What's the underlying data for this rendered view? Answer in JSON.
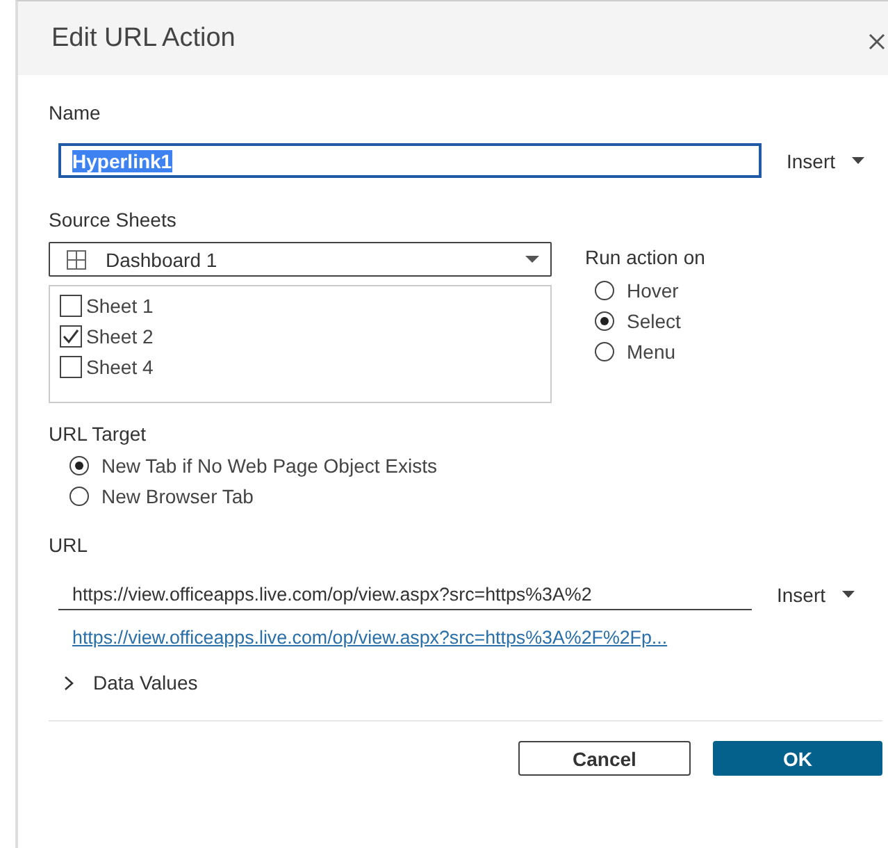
{
  "window": {
    "title": "Edit URL Action"
  },
  "name": {
    "label": "Name",
    "value": "Hyperlink1",
    "insert": "Insert"
  },
  "source_sheets": {
    "label": "Source Sheets",
    "dropdown": "Dashboard 1",
    "sheets": [
      {
        "label": "Sheet 1",
        "checked": false
      },
      {
        "label": "Sheet 2",
        "checked": true
      },
      {
        "label": "Sheet 4",
        "checked": false
      }
    ]
  },
  "run_action_on": {
    "label": "Run action on",
    "options": [
      {
        "label": "Hover",
        "selected": false
      },
      {
        "label": "Select",
        "selected": true
      },
      {
        "label": "Menu",
        "selected": false
      }
    ]
  },
  "url_target": {
    "label": "URL Target",
    "options": [
      {
        "label": "New Tab if No Web Page Object Exists",
        "selected": true
      },
      {
        "label": "New Browser Tab",
        "selected": false
      }
    ]
  },
  "url": {
    "label": "URL",
    "value": "https://view.officeapps.live.com/op/view.aspx?src=https%3A%2",
    "insert": "Insert",
    "preview": "https://view.officeapps.live.com/op/view.aspx?src=https%3A%2F%2Fp..."
  },
  "data_values": {
    "label": "Data Values",
    "expanded": false
  },
  "buttons": [
    "Cancel",
    "OK"
  ]
}
